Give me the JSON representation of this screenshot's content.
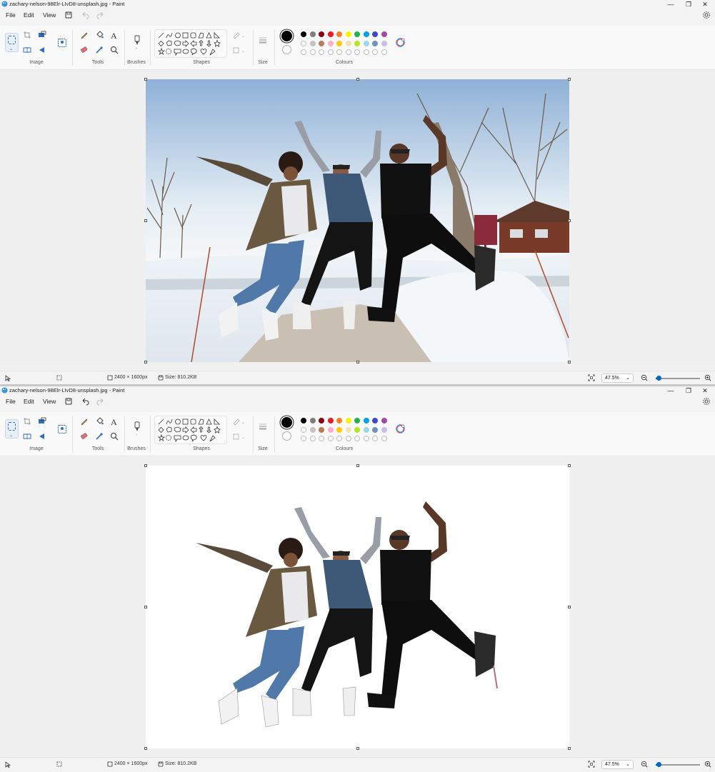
{
  "windows": [
    {
      "title": "zachary-nelson-98Elr-LIvD8-unsplash.jpg - Paint",
      "state": "original",
      "controls": {
        "minimize": "—",
        "maximize": "❐",
        "close": "✕"
      },
      "menu": {
        "file": "File",
        "edit": "Edit",
        "view": "View"
      },
      "ribbon": {
        "image": "Image",
        "tools": "Tools",
        "brushes": "Brushes",
        "shapes": "Shapes",
        "size": "Size",
        "colours": "Colours"
      },
      "status": {
        "dimensions": "2400 × 1600px",
        "size": "Size: 810.2KB",
        "zoom": "47.5%"
      }
    },
    {
      "title": "zachary-nelson-98Elr-LIvD8-unsplash.jpg - Paint",
      "state": "background-removed",
      "controls": {
        "minimize": "—",
        "maximize": "❐",
        "close": "✕"
      },
      "menu": {
        "file": "File",
        "edit": "Edit",
        "view": "View"
      },
      "ribbon": {
        "image": "Image",
        "tools": "Tools",
        "brushes": "Brushes",
        "shapes": "Shapes",
        "size": "Size",
        "colours": "Colours"
      },
      "status": {
        "dimensions": "2400 × 1600px",
        "size": "Size: 810.2KB",
        "zoom": "47.5%"
      }
    }
  ],
  "palette": {
    "primary": "#000000",
    "secondary": "#ffffff",
    "row1": [
      "#000000",
      "#7f7f7f",
      "#880015",
      "#ed1c24",
      "#ff7f27",
      "#fff200",
      "#22b14c",
      "#00a2e8",
      "#3f48cc",
      "#a349a4"
    ],
    "row2": [
      "#ffffff",
      "#c3c3c3",
      "#b97a57",
      "#ffaec9",
      "#ffc90e",
      "#efe4b0",
      "#b5e61d",
      "#99d9ea",
      "#7092be",
      "#c8bfe7"
    ]
  },
  "accent": "#0067c0",
  "zoom_level": 0.475
}
